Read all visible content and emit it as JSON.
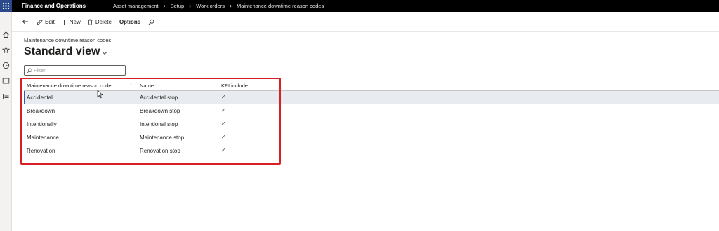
{
  "topbar": {
    "app_title": "Finance and Operations",
    "breadcrumbs": [
      "Asset management",
      "Setup",
      "Work orders",
      "Maintenance downtime reason codes"
    ]
  },
  "leftnav": {
    "icons": [
      "hamburger-icon",
      "home-icon",
      "star-icon",
      "clock-icon",
      "workspace-icon",
      "modules-list-icon"
    ]
  },
  "actionpane": {
    "back_icon": "back-arrow-icon",
    "edit_label": "Edit",
    "new_label": "New",
    "delete_label": "Delete",
    "options_label": "Options",
    "search_icon": "search-icon"
  },
  "page": {
    "caption": "Maintenance downtime reason codes",
    "view_title": "Standard view",
    "filter_placeholder": "Filter"
  },
  "grid": {
    "columns": [
      "Maintenance downtime reason code",
      "Name",
      "KPI include"
    ],
    "rows": [
      {
        "code": "Accidental",
        "name": "Accidental stop",
        "kpi": "✓"
      },
      {
        "code": "Breakdown",
        "name": "Breakdown stop",
        "kpi": "✓"
      },
      {
        "code": "Intentionally",
        "name": "Intentional stop",
        "kpi": "✓"
      },
      {
        "code": "Maintenance",
        "name": "Maintenance stop",
        "kpi": "✓"
      },
      {
        "code": "Renovation",
        "name": "Renovation stop",
        "kpi": "✓"
      }
    ],
    "selected_row": 0
  },
  "colors": {
    "topbar": "#000000",
    "waffle": "#2b4a8c",
    "selection": "#e8ebef",
    "annotation": "#d71f26"
  }
}
